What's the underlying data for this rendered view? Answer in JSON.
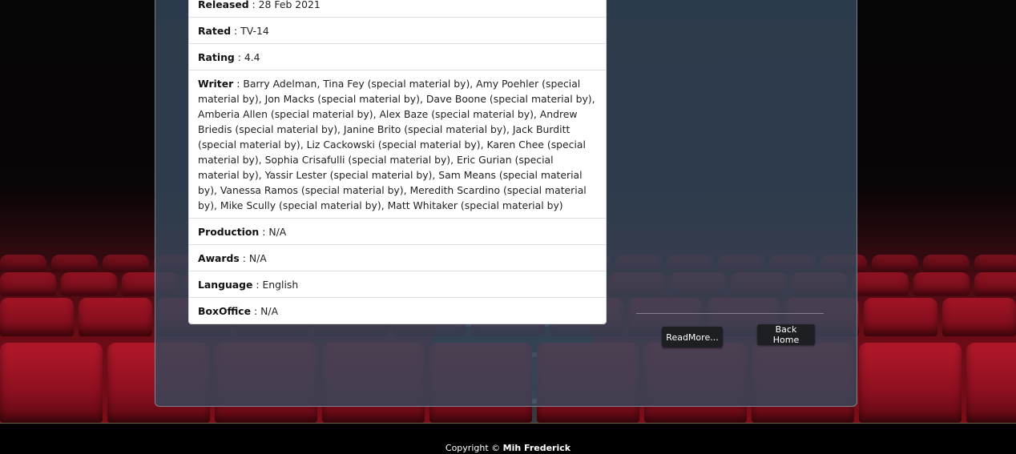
{
  "movie_details": [
    {
      "key": "Released",
      "sep": " : ",
      "value": "28 Feb 2021"
    },
    {
      "key": "Rated",
      "sep": " : ",
      "value": "TV-14"
    },
    {
      "key": "Rating",
      "sep": " : ",
      "value": "4.4"
    },
    {
      "key": "Writer",
      "sep": " : ",
      "value": "Barry Adelman, Tina Fey (special material by), Amy Poehler (special material by), Jon Macks (special material by), Dave Boone (special material by), Amberia Allen (special material by), Alex Baze (special material by), Andrew Briedis (special material by), Janine Brito (special material by), Jack Burditt (special material by), Liz Cackowski (special material by), Karen Chee (special material by), Sophia Crisafulli (special material by), Eric Gurian (special material by), Yassir Lester (special material by), Sam Means (special material by), Vanessa Ramos (special material by), Meredith Scardino (special material by), Mike Scully (special material by), Matt Whitaker (special material by)"
    },
    {
      "key": "Production",
      "sep": " : ",
      "value": "N/A"
    },
    {
      "key": "Awards",
      "sep": " : ",
      "value": "N/A"
    },
    {
      "key": "Language",
      "sep": " : ",
      "value": "English"
    },
    {
      "key": "BoxOffice",
      "sep": " : ",
      "value": "N/A"
    }
  ],
  "actions": {
    "read_more_label": "ReadMore...",
    "back_home_label": "Back Home"
  },
  "footer": {
    "copyright_prefix": "Copyright © ",
    "author": "Mih Frederick"
  },
  "colors": {
    "panel": "#36485c",
    "button": "#1d1f22",
    "seat": "#b3182a"
  }
}
